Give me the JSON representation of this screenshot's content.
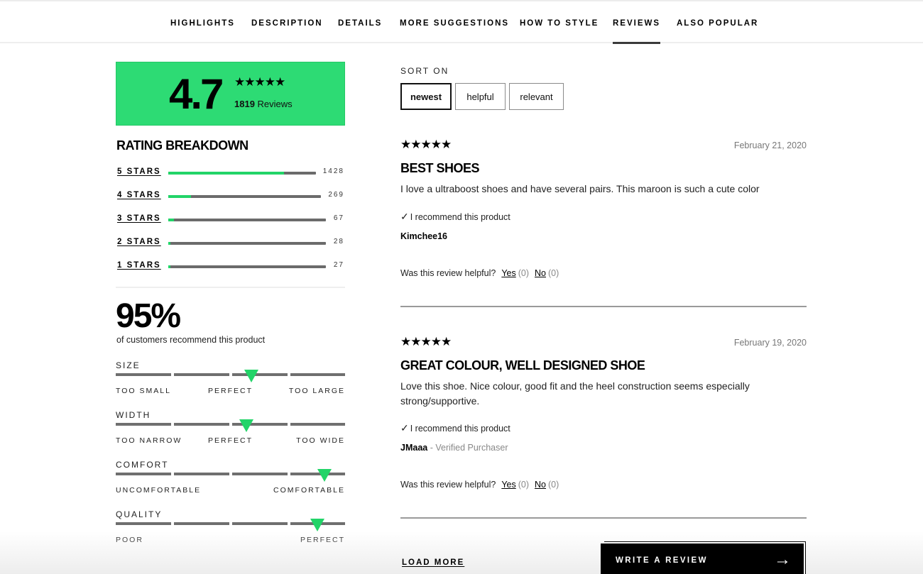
{
  "nav": {
    "items": [
      {
        "label": "HIGHLIGHTS",
        "active": false
      },
      {
        "label": "DESCRIPTION",
        "active": false
      },
      {
        "label": "DETAILS",
        "active": false
      },
      {
        "label": "MORE SUGGESTIONS",
        "active": false
      },
      {
        "label": "HOW TO STYLE",
        "active": false
      },
      {
        "label": "REVIEWS",
        "active": true
      },
      {
        "label": "ALSO POPULAR",
        "active": false
      }
    ]
  },
  "summary": {
    "rating": "4.7",
    "stars": "★★★★★",
    "review_count": "1819",
    "review_count_suffix": "Reviews",
    "accent_color": "#2ddb74"
  },
  "breakdown": {
    "title": "RATING BREAKDOWN",
    "total": 1819,
    "rows": [
      {
        "label": "5 STARS",
        "count": "1428",
        "value": 1428
      },
      {
        "label": "4 STARS",
        "count": "269",
        "value": 269
      },
      {
        "label": "3 STARS",
        "count": "67",
        "value": 67
      },
      {
        "label": "2 STARS",
        "count": "28",
        "value": 28
      },
      {
        "label": "1 STARS",
        "count": "27",
        "value": 27
      }
    ]
  },
  "recommend": {
    "percent": "95%",
    "text": "of customers recommend this product"
  },
  "fit": [
    {
      "title": "SIZE",
      "value": 0.59,
      "labels": [
        {
          "text": "TOO SMALL",
          "pos": "left"
        },
        {
          "text": "PERFECT",
          "pos": "center"
        },
        {
          "text": "TOO LARGE",
          "pos": "right"
        }
      ]
    },
    {
      "title": "WIDTH",
      "value": 0.57,
      "labels": [
        {
          "text": "TOO NARROW",
          "pos": "left"
        },
        {
          "text": "PERFECT",
          "pos": "center"
        },
        {
          "text": "TOO WIDE",
          "pos": "right"
        }
      ]
    },
    {
      "title": "COMFORT",
      "value": 0.91,
      "labels": [
        {
          "text": "UNCOMFORTABLE",
          "pos": "left"
        },
        {
          "text": "COMFORTABLE",
          "pos": "right"
        }
      ]
    },
    {
      "title": "QUALITY",
      "value": 0.88,
      "labels": [
        {
          "text": "POOR",
          "pos": "left"
        },
        {
          "text": "PERFECT",
          "pos": "right"
        }
      ]
    }
  ],
  "sort": {
    "title": "SORT ON",
    "options": [
      {
        "label": "newest",
        "active": true
      },
      {
        "label": "helpful",
        "active": false
      },
      {
        "label": "relevant",
        "active": false
      }
    ]
  },
  "reviews": [
    {
      "stars": "★★★★★",
      "date": "February 21, 2020",
      "title": "BEST SHOES",
      "body": "I love a ultraboost shoes and have several pairs. This maroon is such a cute color",
      "recommend": "I recommend this product",
      "user": "Kimchee16",
      "verified": "",
      "helpful_q": "Was this review helpful?",
      "yes": "Yes",
      "yes_count": "(0)",
      "no": "No",
      "no_count": "(0)"
    },
    {
      "stars": "★★★★★",
      "date": "February 19, 2020",
      "title": "GREAT COLOUR, WELL DESIGNED SHOE",
      "body": "Love this shoe. Nice colour, good fit and the heel construction seems especially strong/supportive.",
      "recommend": "I recommend this product",
      "user": "JMaaa",
      "verified": " - Verified Purchaser",
      "helpful_q": "Was this review helpful?",
      "yes": "Yes",
      "yes_count": "(0)",
      "no": "No",
      "no_count": "(0)"
    }
  ],
  "footer": {
    "load_more": "LOAD MORE",
    "write_review": "WRITE A REVIEW",
    "arrow_icon": "→"
  }
}
